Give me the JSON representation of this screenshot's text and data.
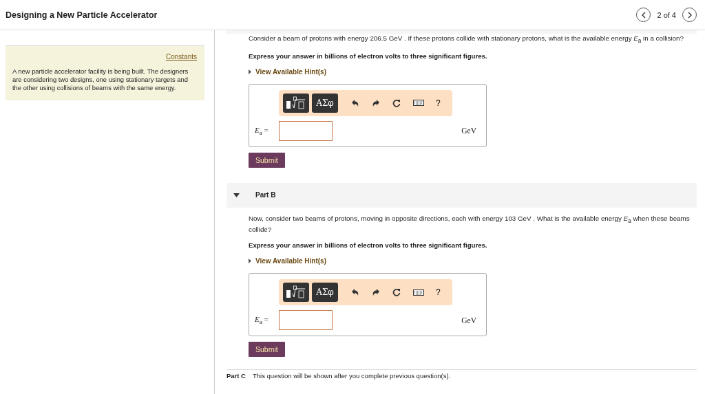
{
  "title": "Designing a New Particle Accelerator",
  "pager": {
    "position": "2 of 4"
  },
  "sidebar": {
    "link": "Constants",
    "text": "A new particle accelerator facility is being built. The designers are considering two designs, one using stationary targets and the other using collisions of beams with the same energy."
  },
  "parts": [
    {
      "question": "Consider a beam of protons with energy 206.5 GeV . If these protons collide with stationary protons, what is the available energy *E*$_{a}$ in a collision?",
      "instruction": "Express your answer in billions of electron volts to three significant figures.",
      "hint": "View Available Hint(s)",
      "toolbar": {
        "symbols": "ΑΣφ",
        "help": "?"
      },
      "variable": "*E*$_{a}$ =",
      "unit": "GeV",
      "submit": "Submit"
    },
    {
      "header": "Part B",
      "expanded": true,
      "question": "Now, consider two beams of protons, moving in opposite directions, each with energy 103 GeV . What is the available energy *E*$_{a}$ when these beams collide?",
      "instruction": "Express your answer in billions of electron volts to three significant figures.",
      "hint": "View Available Hint(s)",
      "toolbar": {
        "symbols": "ΑΣφ",
        "help": "?"
      },
      "variable": "*E*$_{a}$ =",
      "unit": "GeV",
      "submit": "Submit"
    }
  ],
  "locked_part": {
    "label": "Part C",
    "note": "This question will be shown after you complete previous question(s)."
  }
}
